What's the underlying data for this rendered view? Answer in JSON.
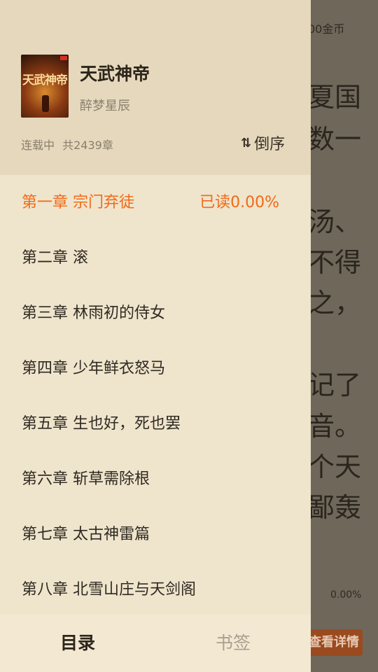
{
  "reader": {
    "coins": "00金币",
    "lines": [
      "夏国",
      "数一",
      "",
      "汤、",
      "不得",
      "之，",
      "",
      "记了",
      "音。",
      "个天",
      "鄙轰"
    ],
    "progress": "0.00%",
    "detail_button": "查看详情"
  },
  "book": {
    "cover_title": "天武神帝",
    "title": "天武神帝",
    "author": "醉梦星辰",
    "status": "连载中",
    "chapter_count": "共2439章",
    "sort_label": "倒序",
    "sort_icon": "sort-arrows-icon"
  },
  "chapters": [
    {
      "title": "第一章  宗门弃徒",
      "read": "已读0.00%",
      "current": true
    },
    {
      "title": "第二章 滚"
    },
    {
      "title": "第三章 林雨初的侍女"
    },
    {
      "title": "第四章 少年鲜衣怒马"
    },
    {
      "title": "第五章 生也好，死也罢"
    },
    {
      "title": "第六章 斩草需除根"
    },
    {
      "title": "第七章 太古神雷篇"
    },
    {
      "title": "第八章 北雪山庄与天剑阁"
    }
  ],
  "tabs": {
    "catalog": "目录",
    "bookmarks": "书签"
  },
  "colors": {
    "accent": "#f06a18",
    "drawer_bg": "#efe4cc",
    "header_bg": "#e5d8bd"
  }
}
